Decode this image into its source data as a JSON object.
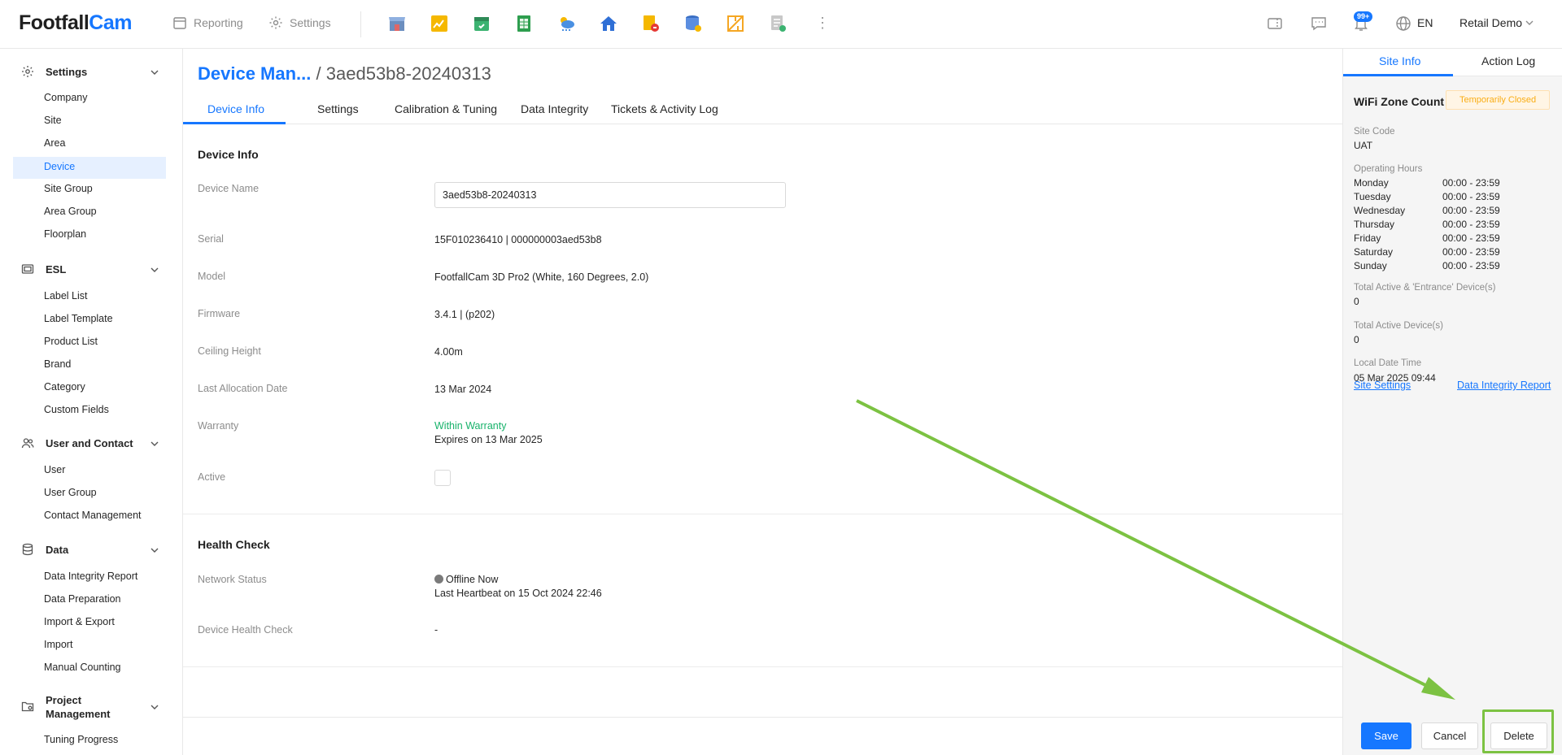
{
  "brand": {
    "part1": "Footfall",
    "part2": "Cam"
  },
  "topnav": {
    "reporting": "Reporting",
    "settings": "Settings"
  },
  "app_icons": [
    "store-icon",
    "chart-icon",
    "calendar-icon",
    "spreadsheet-icon",
    "weather-icon",
    "home-icon",
    "alert-tag-icon",
    "database-icon",
    "layout-icon",
    "report-icon"
  ],
  "header": {
    "notification_badge": "99+",
    "language": "EN",
    "account": "Retail Demo"
  },
  "sidebar": {
    "settings": {
      "title": "Settings",
      "items": [
        "Company",
        "Site",
        "Area",
        "Device",
        "Site Group",
        "Area Group",
        "Floorplan"
      ]
    },
    "esl": {
      "title": "ESL",
      "items": [
        "Label List",
        "Label Template",
        "Product List",
        "Brand",
        "Category",
        "Custom Fields"
      ]
    },
    "user": {
      "title": "User and Contact",
      "items": [
        "User",
        "User Group",
        "Contact Management"
      ]
    },
    "data": {
      "title": "Data",
      "items": [
        "Data Integrity Report",
        "Data Preparation",
        "Import & Export",
        "Import",
        "Manual Counting"
      ]
    },
    "project": {
      "title_line1": "Project",
      "title_line2": "Management",
      "items": [
        "Tuning Progress"
      ]
    }
  },
  "breadcrumb": {
    "parent": "Device Man...",
    "sep": "/",
    "current": "3aed53b8-20240313"
  },
  "tabs": [
    "Device Info",
    "Settings",
    "Calibration & Tuning",
    "Data Integrity",
    "Tickets & Activity Log"
  ],
  "device_info": {
    "section_title": "Device Info",
    "labels": {
      "name": "Device Name",
      "serial": "Serial",
      "model": "Model",
      "firmware": "Firmware",
      "ceiling": "Ceiling Height",
      "allocation": "Last Allocation Date",
      "warranty": "Warranty",
      "active": "Active"
    },
    "values": {
      "name": "3aed53b8-20240313",
      "serial": "15F010236410 | 000000003aed53b8",
      "model": "FootfallCam 3D Pro2 (White, 160 Degrees, 2.0)",
      "firmware": "3.4.1 | (p202)",
      "ceiling": "4.00m",
      "allocation": "13 Mar 2024",
      "warranty_status": "Within Warranty",
      "warranty_expiry": "Expires on 13 Mar 2025"
    },
    "active": false
  },
  "health": {
    "section_title": "Health Check",
    "labels": {
      "network": "Network Status",
      "health": "Device Health Check"
    },
    "values": {
      "network": "Offline Now",
      "heartbeat": "Last Heartbeat on 15 Oct 2024 22:46",
      "health": "-"
    }
  },
  "footer": {
    "save": "Save",
    "cancel": "Cancel",
    "delete": "Delete"
  },
  "right_panel": {
    "tabs": [
      "Site Info",
      "Action Log"
    ],
    "title": "WiFi Zone Count",
    "status": "Temporarily Closed",
    "site_code_label": "Site Code",
    "site_code": "UAT",
    "hours_label": "Operating Hours",
    "hours": [
      {
        "day": "Monday",
        "range": "00:00 - 23:59"
      },
      {
        "day": "Tuesday",
        "range": "00:00 - 23:59"
      },
      {
        "day": "Wednesday",
        "range": "00:00 - 23:59"
      },
      {
        "day": "Thursday",
        "range": "00:00 - 23:59"
      },
      {
        "day": "Friday",
        "range": "00:00 - 23:59"
      },
      {
        "day": "Saturday",
        "range": "00:00 - 23:59"
      },
      {
        "day": "Sunday",
        "range": "00:00 - 23:59"
      }
    ],
    "entrance_label": "Total Active & 'Entrance' Device(s)",
    "entrance_value": "0",
    "active_label": "Total Active Device(s)",
    "active_value": "0",
    "datetime_label": "Local Date Time",
    "datetime_value": "05 Mar 2025 09:44",
    "links": {
      "site_settings": "Site Settings",
      "integrity": "Data Integrity Report"
    }
  },
  "colors": {
    "accent": "#1677ff",
    "highlight": "#7cc242",
    "warranty": "#17b26a",
    "status": "#faad14"
  }
}
